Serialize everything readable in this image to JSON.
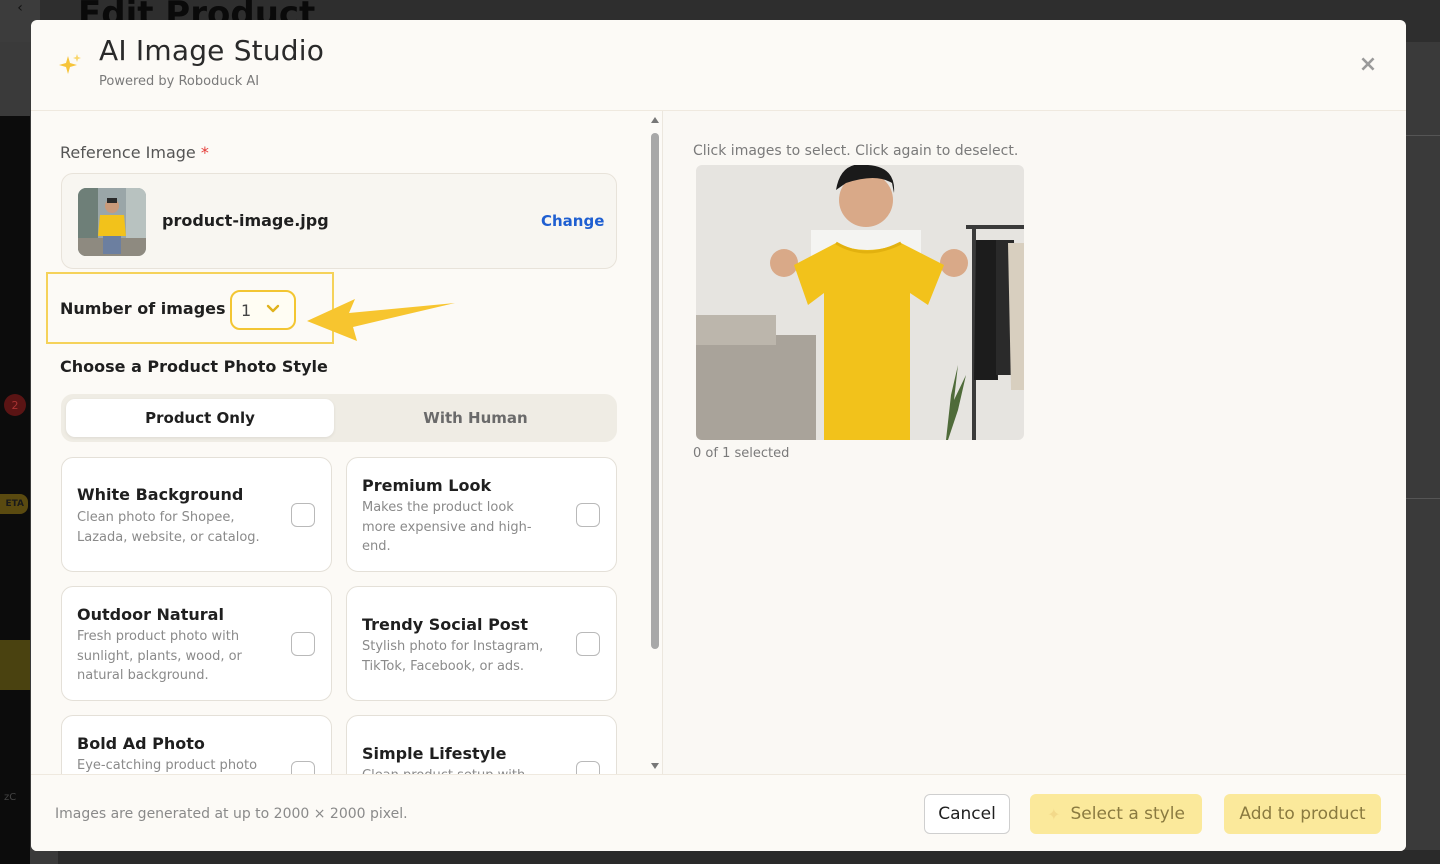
{
  "background": {
    "page_title": "Edit Product",
    "badge": "2",
    "beta": "ETA",
    "side_text": "zC"
  },
  "modal": {
    "title": "AI Image Studio",
    "subtitle": "Powered by Roboduck AI",
    "close_icon": "close-icon"
  },
  "reference": {
    "label": "Reference Image",
    "required_mark": "*",
    "filename": "product-image.jpg",
    "change_label": "Change"
  },
  "num_images": {
    "label": "Number of images",
    "value": "1"
  },
  "style": {
    "label": "Choose a Product Photo Style",
    "tabs": [
      "Product Only",
      "With Human"
    ],
    "active_tab": "Product Only",
    "cards": [
      {
        "title": "White Background",
        "desc": "Clean photo for Shopee, Lazada, website, or catalog.",
        "checked": false
      },
      {
        "title": "Premium Look",
        "desc": "Makes the product look more expensive and high-end.",
        "checked": false
      },
      {
        "title": "Outdoor Natural",
        "desc": "Fresh product photo with sunlight, plants, wood, or natural background.",
        "checked": false
      },
      {
        "title": "Trendy Social Post",
        "desc": "Stylish photo for Instagram, TikTok, Facebook, or ads.",
        "checked": false
      },
      {
        "title": "Bold Ad Photo",
        "desc": "Eye-catching product photo",
        "checked": false
      },
      {
        "title": "Simple Lifestyle",
        "desc": "Clean product setup with",
        "checked": false
      }
    ]
  },
  "results": {
    "hint": "Click images to select. Click again to deselect.",
    "selected_text": "0 of 1 selected"
  },
  "footer": {
    "note": "Images are generated at up to 2000 × 2000 pixel.",
    "cancel": "Cancel",
    "select_style": "Select a style",
    "add_to_product": "Add to product"
  },
  "colors": {
    "accent_yellow": "#f3c632",
    "button_disabled_yellow": "#fbe99b",
    "link_blue": "#1f5fd1",
    "required_red": "#e53935"
  }
}
